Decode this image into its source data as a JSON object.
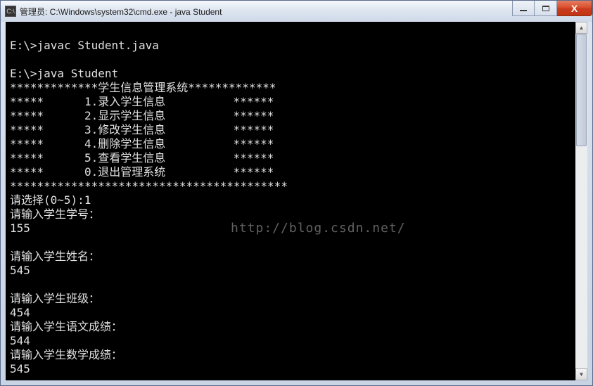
{
  "window": {
    "icon_label": "C:\\",
    "title": "管理员: C:\\Windows\\system32\\cmd.exe - java  Student"
  },
  "terminal": {
    "lines": [
      "",
      "E:\\>javac Student.java",
      "",
      "E:\\>java Student",
      "*************学生信息管理系统*************",
      "*****      1.录入学生信息          ******",
      "*****      2.显示学生信息          ******",
      "*****      3.修改学生信息          ******",
      "*****      4.删除学生信息          ******",
      "*****      5.查看学生信息          ******",
      "*****      0.退出管理系统          ******",
      "*****************************************",
      "请选择(0~5):1",
      "请输入学生学号：",
      "155",
      "",
      "请输入学生姓名：",
      "545",
      "",
      "请输入学生班级：",
      "454",
      "请输入学生语文成绩：",
      "544",
      "请输入学生数学成绩：",
      "545"
    ]
  },
  "watermark": "http://blog.csdn.net/"
}
